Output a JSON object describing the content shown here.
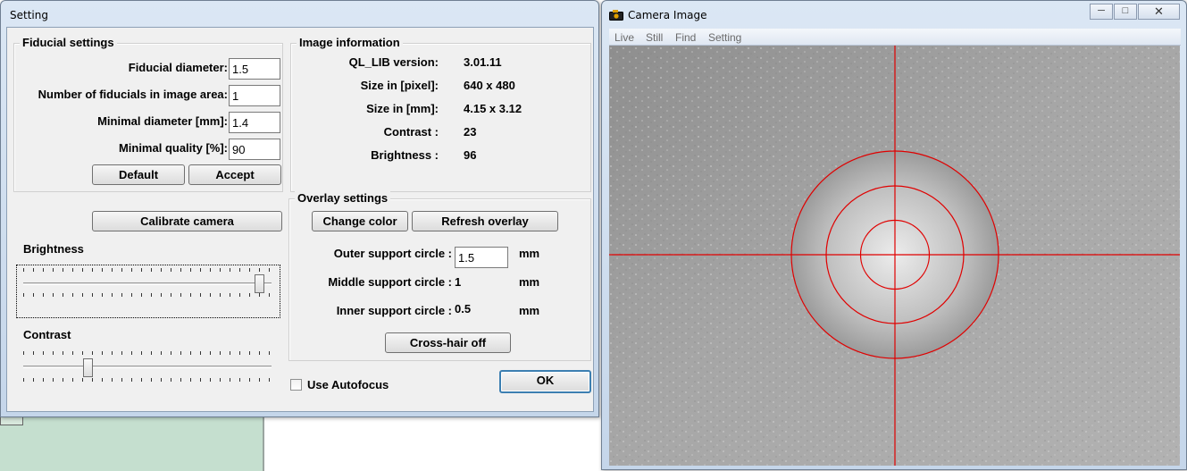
{
  "setting_window": {
    "title": "Setting",
    "fiducial": {
      "group_title": "Fiducial settings",
      "diameter_label": "Fiducial diameter:",
      "diameter_value": "1.5",
      "count_label": "Number of fiducials in image area:",
      "count_value": "1",
      "min_diameter_label": "Minimal diameter [mm]:",
      "min_diameter_value": "1.4",
      "min_quality_label": "Minimal quality [%]:",
      "min_quality_value": "90",
      "default_label": "Default",
      "accept_label": "Accept"
    },
    "image_info": {
      "group_title": "Image information",
      "rows": [
        {
          "label": "QL_LIB version:",
          "value": "3.01.11"
        },
        {
          "label": "Size in [pixel]:",
          "value": "640 x 480"
        },
        {
          "label": "Size in [mm]:",
          "value": "4.15 x 3.12"
        },
        {
          "label": "Contrast :",
          "value": "23"
        },
        {
          "label": "Brightness :",
          "value": "96"
        }
      ]
    },
    "calibrate_label": "Calibrate camera",
    "brightness_label": "Brightness",
    "brightness_level": 0.97,
    "contrast_label": "Contrast",
    "contrast_level": 0.25,
    "overlay": {
      "group_title": "Overlay settings",
      "change_color_label": "Change color",
      "refresh_label": "Refresh overlay",
      "outer_label": "Outer support circle :",
      "outer_value": "1.5",
      "middle_label": "Middle support circle :",
      "middle_value": "1",
      "inner_label": "Inner support circle :",
      "inner_value": "0.5",
      "unit": "mm",
      "crosshair_label": "Cross-hair off"
    },
    "autofocus_label": "Use Autofocus",
    "ok_label": "OK"
  },
  "camera_window": {
    "title": "Camera Image",
    "menu": [
      "Live",
      "Still",
      "Find",
      "Setting"
    ],
    "overlay_color": "#e00000"
  }
}
